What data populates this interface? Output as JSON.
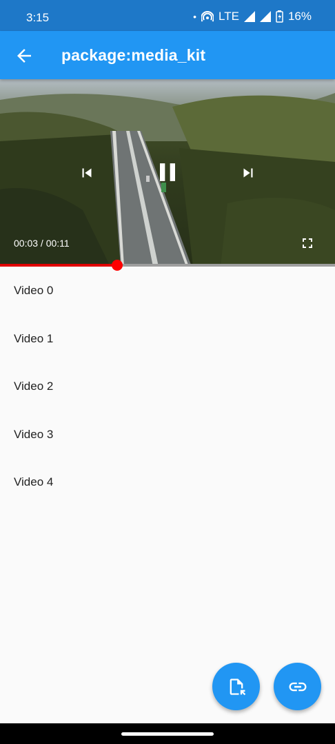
{
  "status_bar": {
    "time": "3:15",
    "dot": "•",
    "network": "LTE",
    "battery": "16%",
    "icons": [
      "hotspot-icon",
      "signal-icon",
      "signal-icon",
      "battery-icon"
    ]
  },
  "app_bar": {
    "title": "package:media_kit",
    "back_icon": "arrow-back-icon"
  },
  "player": {
    "position": "00:03",
    "separator": " / ",
    "duration": "00:11",
    "time_display": "00:03 / 00:11",
    "progress_fraction": 0.35,
    "state": "playing",
    "icons": [
      "skip-previous-icon",
      "pause-icon",
      "skip-next-icon",
      "fullscreen-icon"
    ],
    "progress_color": "#ff0000"
  },
  "videos": [
    "Video 0",
    "Video 1",
    "Video 2",
    "Video 3",
    "Video 4"
  ],
  "fabs": [
    {
      "icon": "file-open-icon"
    },
    {
      "icon": "link-icon"
    }
  ],
  "colors": {
    "primary": "#2196f3",
    "status_bar": "#1e78c8",
    "background": "#fafafa"
  }
}
